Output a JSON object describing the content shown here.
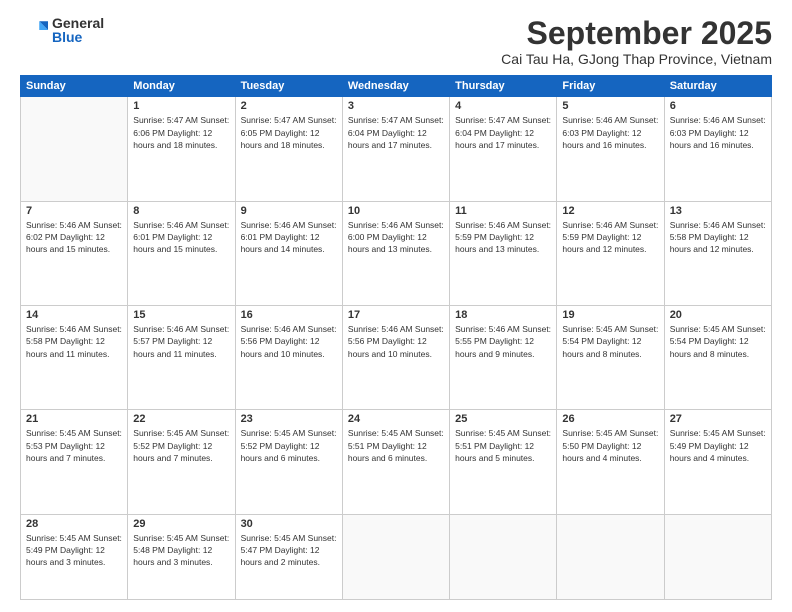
{
  "logo": {
    "general": "General",
    "blue": "Blue"
  },
  "header": {
    "month": "September 2025",
    "location": "Cai Tau Ha, GJong Thap Province, Vietnam"
  },
  "weekdays": [
    "Sunday",
    "Monday",
    "Tuesday",
    "Wednesday",
    "Thursday",
    "Friday",
    "Saturday"
  ],
  "weeks": [
    [
      {
        "num": "",
        "info": ""
      },
      {
        "num": "1",
        "info": "Sunrise: 5:47 AM\nSunset: 6:06 PM\nDaylight: 12 hours\nand 18 minutes."
      },
      {
        "num": "2",
        "info": "Sunrise: 5:47 AM\nSunset: 6:05 PM\nDaylight: 12 hours\nand 18 minutes."
      },
      {
        "num": "3",
        "info": "Sunrise: 5:47 AM\nSunset: 6:04 PM\nDaylight: 12 hours\nand 17 minutes."
      },
      {
        "num": "4",
        "info": "Sunrise: 5:47 AM\nSunset: 6:04 PM\nDaylight: 12 hours\nand 17 minutes."
      },
      {
        "num": "5",
        "info": "Sunrise: 5:46 AM\nSunset: 6:03 PM\nDaylight: 12 hours\nand 16 minutes."
      },
      {
        "num": "6",
        "info": "Sunrise: 5:46 AM\nSunset: 6:03 PM\nDaylight: 12 hours\nand 16 minutes."
      }
    ],
    [
      {
        "num": "7",
        "info": "Sunrise: 5:46 AM\nSunset: 6:02 PM\nDaylight: 12 hours\nand 15 minutes."
      },
      {
        "num": "8",
        "info": "Sunrise: 5:46 AM\nSunset: 6:01 PM\nDaylight: 12 hours\nand 15 minutes."
      },
      {
        "num": "9",
        "info": "Sunrise: 5:46 AM\nSunset: 6:01 PM\nDaylight: 12 hours\nand 14 minutes."
      },
      {
        "num": "10",
        "info": "Sunrise: 5:46 AM\nSunset: 6:00 PM\nDaylight: 12 hours\nand 13 minutes."
      },
      {
        "num": "11",
        "info": "Sunrise: 5:46 AM\nSunset: 5:59 PM\nDaylight: 12 hours\nand 13 minutes."
      },
      {
        "num": "12",
        "info": "Sunrise: 5:46 AM\nSunset: 5:59 PM\nDaylight: 12 hours\nand 12 minutes."
      },
      {
        "num": "13",
        "info": "Sunrise: 5:46 AM\nSunset: 5:58 PM\nDaylight: 12 hours\nand 12 minutes."
      }
    ],
    [
      {
        "num": "14",
        "info": "Sunrise: 5:46 AM\nSunset: 5:58 PM\nDaylight: 12 hours\nand 11 minutes."
      },
      {
        "num": "15",
        "info": "Sunrise: 5:46 AM\nSunset: 5:57 PM\nDaylight: 12 hours\nand 11 minutes."
      },
      {
        "num": "16",
        "info": "Sunrise: 5:46 AM\nSunset: 5:56 PM\nDaylight: 12 hours\nand 10 minutes."
      },
      {
        "num": "17",
        "info": "Sunrise: 5:46 AM\nSunset: 5:56 PM\nDaylight: 12 hours\nand 10 minutes."
      },
      {
        "num": "18",
        "info": "Sunrise: 5:46 AM\nSunset: 5:55 PM\nDaylight: 12 hours\nand 9 minutes."
      },
      {
        "num": "19",
        "info": "Sunrise: 5:45 AM\nSunset: 5:54 PM\nDaylight: 12 hours\nand 8 minutes."
      },
      {
        "num": "20",
        "info": "Sunrise: 5:45 AM\nSunset: 5:54 PM\nDaylight: 12 hours\nand 8 minutes."
      }
    ],
    [
      {
        "num": "21",
        "info": "Sunrise: 5:45 AM\nSunset: 5:53 PM\nDaylight: 12 hours\nand 7 minutes."
      },
      {
        "num": "22",
        "info": "Sunrise: 5:45 AM\nSunset: 5:52 PM\nDaylight: 12 hours\nand 7 minutes."
      },
      {
        "num": "23",
        "info": "Sunrise: 5:45 AM\nSunset: 5:52 PM\nDaylight: 12 hours\nand 6 minutes."
      },
      {
        "num": "24",
        "info": "Sunrise: 5:45 AM\nSunset: 5:51 PM\nDaylight: 12 hours\nand 6 minutes."
      },
      {
        "num": "25",
        "info": "Sunrise: 5:45 AM\nSunset: 5:51 PM\nDaylight: 12 hours\nand 5 minutes."
      },
      {
        "num": "26",
        "info": "Sunrise: 5:45 AM\nSunset: 5:50 PM\nDaylight: 12 hours\nand 4 minutes."
      },
      {
        "num": "27",
        "info": "Sunrise: 5:45 AM\nSunset: 5:49 PM\nDaylight: 12 hours\nand 4 minutes."
      }
    ],
    [
      {
        "num": "28",
        "info": "Sunrise: 5:45 AM\nSunset: 5:49 PM\nDaylight: 12 hours\nand 3 minutes."
      },
      {
        "num": "29",
        "info": "Sunrise: 5:45 AM\nSunset: 5:48 PM\nDaylight: 12 hours\nand 3 minutes."
      },
      {
        "num": "30",
        "info": "Sunrise: 5:45 AM\nSunset: 5:47 PM\nDaylight: 12 hours\nand 2 minutes."
      },
      {
        "num": "",
        "info": ""
      },
      {
        "num": "",
        "info": ""
      },
      {
        "num": "",
        "info": ""
      },
      {
        "num": "",
        "info": ""
      }
    ]
  ]
}
